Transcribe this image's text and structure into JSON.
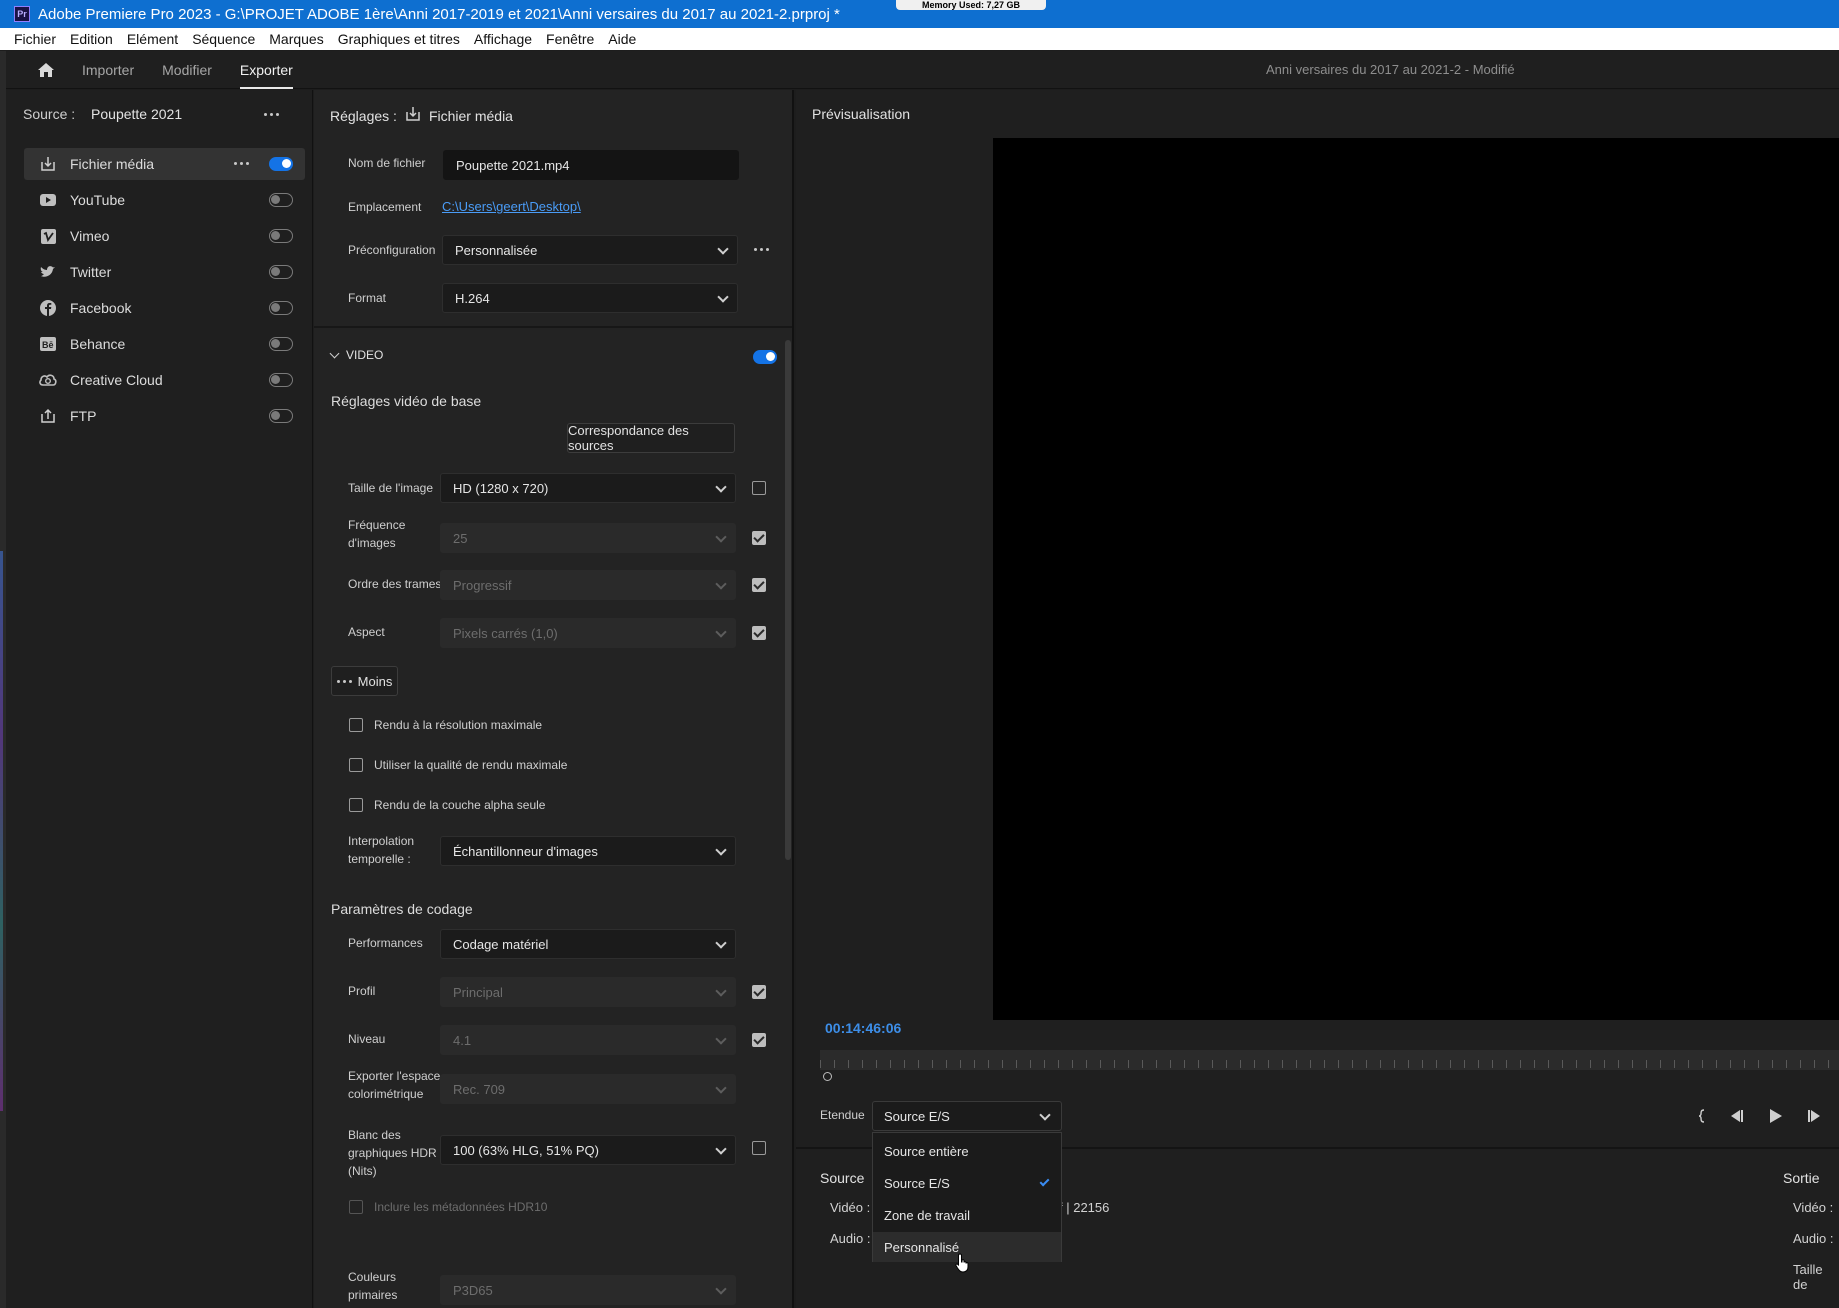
{
  "window": {
    "app_title": "Adobe Premiere Pro 2023 - G:\\PROJET ADOBE 1ère\\Anni 2017-2019 et 2021\\Anni versaires du 2017 au 2021-2.prproj *",
    "memory": "Memory Used: 7,27 GB",
    "logo": "Pr"
  },
  "menu": [
    "Fichier",
    "Edition",
    "Elément",
    "Séquence",
    "Marques",
    "Graphiques et titres",
    "Affichage",
    "Fenêtre",
    "Aide"
  ],
  "header": {
    "tabs": [
      "Importer",
      "Modifier",
      "Exporter"
    ],
    "active_tab": "Exporter",
    "project_title": "Anni versaires du 2017 au 2021-2",
    "project_status": " - Modifié"
  },
  "source": {
    "label": "Source :",
    "name": "Poupette 2021",
    "destinations": [
      {
        "label": "Fichier média",
        "icon": "export-icon",
        "enabled": true,
        "selected": true
      },
      {
        "label": "YouTube",
        "icon": "youtube-icon",
        "enabled": false
      },
      {
        "label": "Vimeo",
        "icon": "vimeo-icon",
        "enabled": false
      },
      {
        "label": "Twitter",
        "icon": "twitter-icon",
        "enabled": false
      },
      {
        "label": "Facebook",
        "icon": "facebook-icon",
        "enabled": false
      },
      {
        "label": "Behance",
        "icon": "behance-icon",
        "enabled": false
      },
      {
        "label": "Creative Cloud",
        "icon": "creative-cloud-icon",
        "enabled": false
      },
      {
        "label": "FTP",
        "icon": "ftp-icon",
        "enabled": false
      }
    ]
  },
  "settings": {
    "title": "Réglages :",
    "dest": "Fichier média",
    "filename_label": "Nom de fichier",
    "filename": "Poupette 2021.mp4",
    "location_label": "Emplacement",
    "location": "C:\\Users\\geert\\Desktop\\",
    "preset_label": "Préconfiguration",
    "preset": "Personnalisée",
    "format_label": "Format",
    "format": "H.264",
    "video_section": "VIDEO",
    "basic_title": "Réglages vidéo de base",
    "match_source": "Correspondance des sources",
    "frame_size_label": "Taille de l'image",
    "frame_size": "HD (1280 x 720)",
    "frame_rate_label_1": "Fréquence",
    "frame_rate_label_2": "d'images",
    "frame_rate": "25",
    "field_order_label": "Ordre des trames",
    "field_order": "Progressif",
    "aspect_label": "Aspect",
    "aspect": "Pixels carrés (1,0)",
    "less_button": "Moins",
    "opt_max_res": "Rendu à la résolution maximale",
    "opt_max_quality": "Utiliser la qualité de rendu maximale",
    "opt_alpha": "Rendu de la couche alpha seule",
    "interp_label_1": "Interpolation",
    "interp_label_2": "temporelle :",
    "interp": "Échantillonneur d'images",
    "encoding_title": "Paramètres de codage",
    "performance_label": "Performances",
    "performance": "Codage matériel",
    "profile_label": "Profil",
    "profile": "Principal",
    "level_label": "Niveau",
    "level": "4.1",
    "colorspace_label_1": "Exporter l'espace",
    "colorspace_label_2": "colorimétrique",
    "colorspace": "Rec. 709",
    "hdr_white_label_1": "Blanc des",
    "hdr_white_label_2": "graphiques HDR",
    "hdr_white_label_3": "(Nits)",
    "hdr_white": "100 (63% HLG, 51% PQ)",
    "hdr10_meta": "Inclure les métadonnées HDR10",
    "primaries_label_1": "Couleurs",
    "primaries_label_2": "primaires",
    "primaries": "P3D65"
  },
  "preview": {
    "title": "Prévisualisation",
    "timecode": "00:14:46:06",
    "range_label": "Etendue",
    "range_value": "Source E/S",
    "range_options": [
      "Source entière",
      "Source E/S",
      "Zone de travail",
      "Personnalisé"
    ],
    "source_label": "Source",
    "output_label": "Sortie",
    "video_label": "Vidéo :",
    "audio_label": "Audio :",
    "source_video_tail": "f | 22156",
    "output_size_label": "Taille de"
  }
}
